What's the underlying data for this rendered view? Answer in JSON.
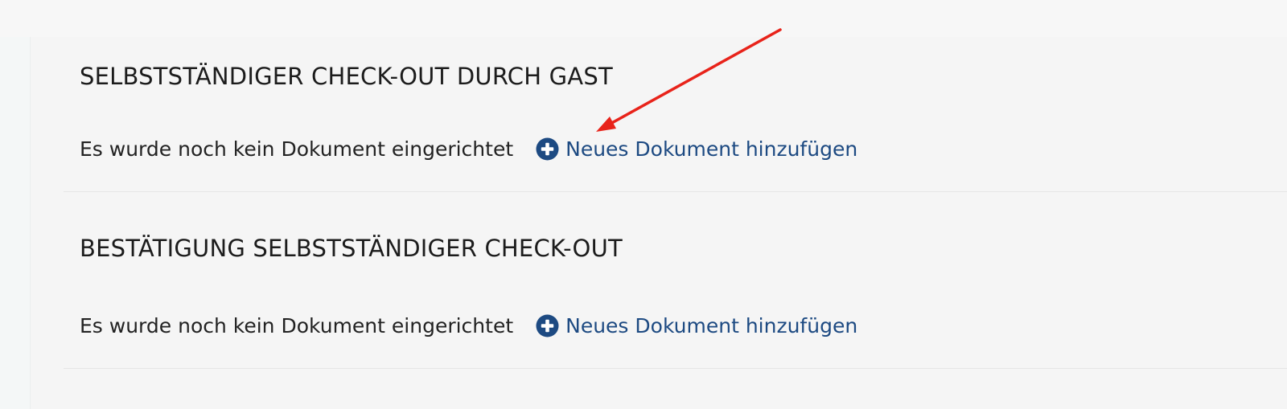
{
  "sections": [
    {
      "title": "SELBSTSTÄNDIGER CHECK-OUT DURCH GAST",
      "empty_text": "Es wurde noch kein Dokument eingerichtet",
      "add_label": "Neues Dokument hinzufügen",
      "add_icon": "plus-circle-icon"
    },
    {
      "title": "BESTÄTIGUNG SELBSTSTÄNDIGER CHECK-OUT",
      "empty_text": "Es wurde noch kein Dokument eingerichtet",
      "add_label": "Neues Dokument hinzufügen",
      "add_icon": "plus-circle-icon"
    }
  ],
  "annotation": {
    "icon": "red-arrow-icon",
    "color": "#e8231a"
  },
  "colors": {
    "link": "#1d4a82",
    "icon_fill": "#1d4a82",
    "text": "#222222",
    "background": "#f5f5f5"
  }
}
